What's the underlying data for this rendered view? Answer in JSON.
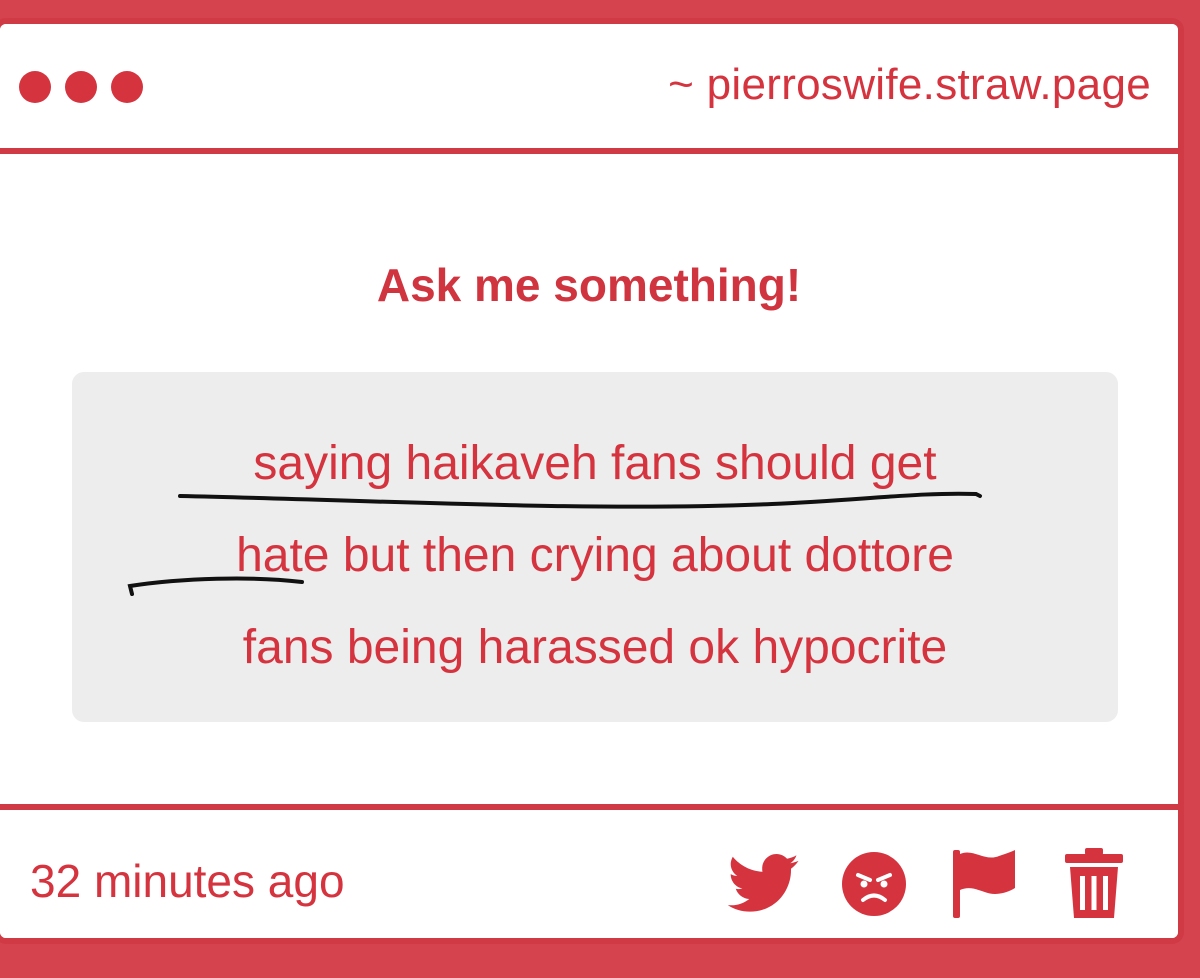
{
  "window": {
    "url": "~ pierroswife.straw.page"
  },
  "main": {
    "heading": "Ask me something!",
    "question": {
      "line1": "saying haikaveh fans should get",
      "line2": "hate but then crying about dottore",
      "line3": "fans being harassed ok hypocrite"
    }
  },
  "footer": {
    "timestamp": "32 minutes ago",
    "actions": [
      {
        "icon": "twitter-icon"
      },
      {
        "icon": "angry-face-icon"
      },
      {
        "icon": "flag-icon"
      },
      {
        "icon": "trash-icon"
      }
    ]
  },
  "colors": {
    "accent": "#d5343f",
    "frame": "#cf3a45",
    "question_bg": "#ededee",
    "scribble": "#111111"
  }
}
